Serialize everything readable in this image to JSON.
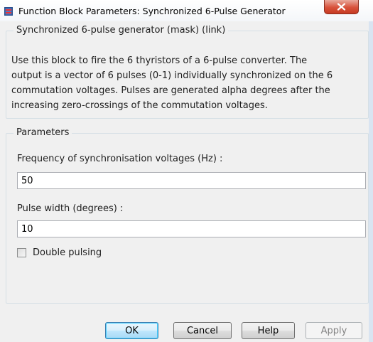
{
  "window": {
    "title": "Function Block Parameters: Synchronized 6-Pulse Generator",
    "close_symbol": "x",
    "icon": "simulink-block-icon"
  },
  "description": {
    "group_title": "Synchronized 6-pulse generator (mask) (link)",
    "lines": [
      "Use this block to fire the 6 thyristors of a 6-pulse converter. The",
      "output is a vector of 6 pulses (0-1) individually synchronized on the 6",
      "commutation voltages. Pulses are generated alpha degrees after the",
      "increasing zero-crossings of the commutation voltages."
    ]
  },
  "parameters": {
    "group_title": "Parameters",
    "frequency": {
      "label": "Frequency of synchronisation voltages (Hz) :",
      "value": "50"
    },
    "pulse_width": {
      "label": "Pulse width (degrees) :",
      "value": "10"
    },
    "double_pulsing": {
      "label": "Double pulsing",
      "checked": false
    }
  },
  "buttons": {
    "ok": "OK",
    "cancel": "Cancel",
    "help": "Help",
    "apply": "Apply"
  },
  "colors": {
    "accent_blue": "#3c7fb1",
    "close_red": "#c63a22",
    "dialog_bg": "#f0f0f0"
  }
}
